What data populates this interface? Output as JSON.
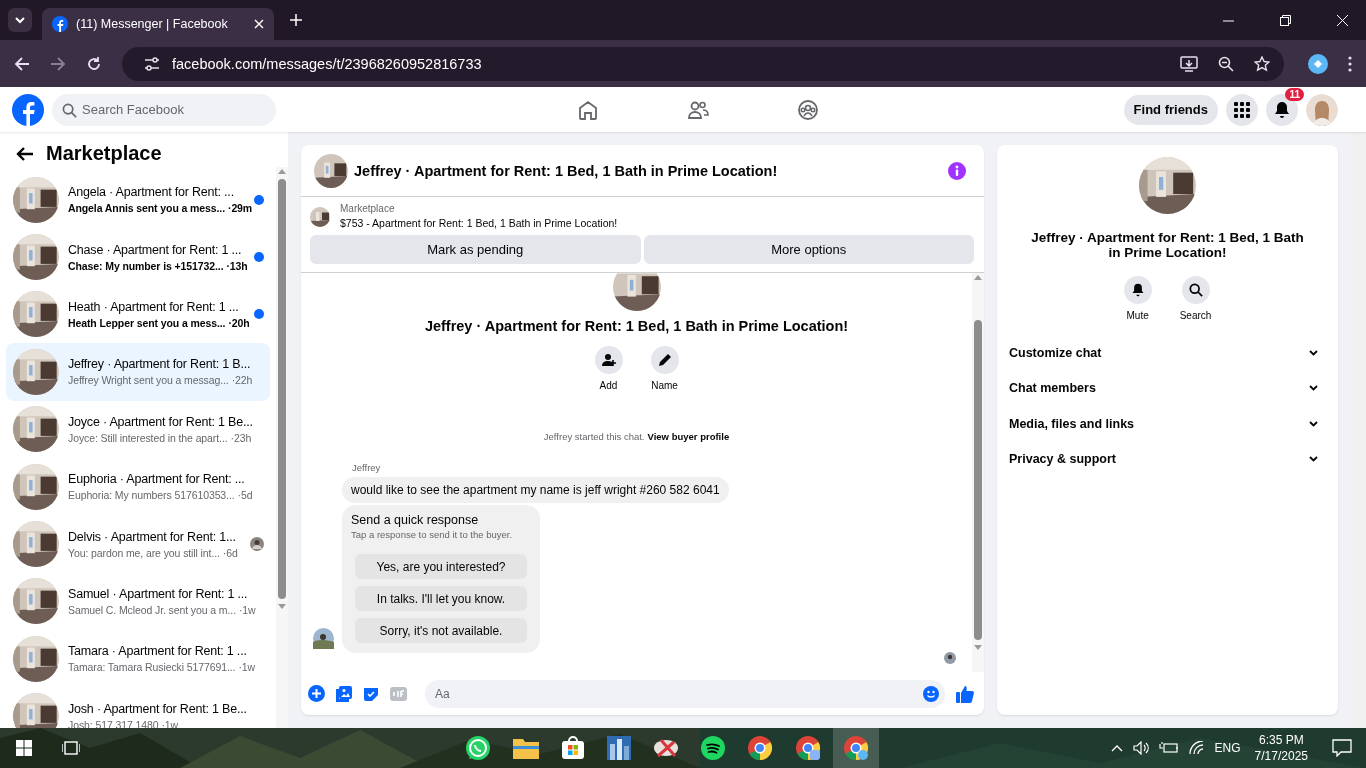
{
  "browser": {
    "tab_title": "(11) Messenger | Facebook",
    "url": "facebook.com/messages/t/23968260952816733"
  },
  "header": {
    "search_placeholder": "Search Facebook",
    "find_friends": "Find friends",
    "notification_count": "11"
  },
  "sidebar": {
    "title": "Marketplace",
    "conversations": [
      {
        "title": "Angela · Apartment for Rent: ...",
        "preview": "Angela Annis sent you a mess...",
        "time": "·29m",
        "unread": true,
        "seen": false,
        "selected": false
      },
      {
        "title": "Chase · Apartment for Rent: 1 ...",
        "preview": "Chase: My number is +151732...",
        "time": "·13h",
        "unread": true,
        "seen": false,
        "selected": false
      },
      {
        "title": "Heath · Apartment for Rent: 1 ...",
        "preview": "Heath Lepper sent you a mess...",
        "time": "·20h",
        "unread": true,
        "seen": false,
        "selected": false
      },
      {
        "title": "Jeffrey · Apartment for Rent: 1 B...",
        "preview": "Jeffrey Wright sent you a messag...",
        "time": "·22h",
        "unread": false,
        "seen": false,
        "selected": true
      },
      {
        "title": "Joyce · Apartment for Rent: 1 Be...",
        "preview": "Joyce: Still interested in the apart...",
        "time": "·23h",
        "unread": false,
        "seen": false,
        "selected": false
      },
      {
        "title": "Euphoria · Apartment for Rent: ...",
        "preview": "Euphoria: My numbers 517610353...",
        "time": "·5d",
        "unread": false,
        "seen": false,
        "selected": false
      },
      {
        "title": "Delvis · Apartment for Rent: 1...",
        "preview": "You: pardon me, are you still int...",
        "time": "·6d",
        "unread": false,
        "seen": true,
        "selected": false
      },
      {
        "title": "Samuel · Apartment for Rent: 1 ...",
        "preview": "Samuel C. Mcleod Jr. sent you a m...",
        "time": "·1w",
        "unread": false,
        "seen": false,
        "selected": false
      },
      {
        "title": "Tamara · Apartment for Rent: 1 ...",
        "preview": "Tamara: Tamara Rusiecki 5177691...",
        "time": "·1w",
        "unread": false,
        "seen": false,
        "selected": false
      },
      {
        "title": "Josh · Apartment for Rent: 1 Be...",
        "preview": "Josh: 517 317 1480",
        "time": "·1w",
        "unread": false,
        "seen": false,
        "selected": false
      }
    ]
  },
  "chat": {
    "title": "Jeffrey · Apartment for Rent: 1 Bed, 1 Bath in Prime Location!",
    "listing": {
      "label": "Marketplace",
      "price_line": "$753 - Apartment for Rent: 1 Bed, 1 Bath in Prime Location!",
      "buttons": [
        "Mark as pending",
        "More options"
      ]
    },
    "intro": {
      "title": "Jeffrey · Apartment for Rent: 1 Bed, 1 Bath in Prime Location!",
      "actions": [
        {
          "label": "Add",
          "kind": "add"
        },
        {
          "label": "Name",
          "kind": "name"
        }
      ]
    },
    "notice": {
      "text": "Jeffrey started this chat.",
      "link": "View buyer profile"
    },
    "sender": "Jeffrey",
    "message": "would like to see the apartment  my name is jeff wright #260 582 6041",
    "quick_response": {
      "title": "Send a quick response",
      "subtitle": "Tap a response to send it to the buyer.",
      "options": [
        "Yes, are you interested?",
        "In talks. I'll let you know.",
        "Sorry, it's not available."
      ]
    },
    "composer_placeholder": "Aa"
  },
  "details": {
    "title": "Jeffrey · Apartment for Rent: 1 Bed, 1 Bath in Prime Location!",
    "actions": [
      {
        "label": "Mute",
        "kind": "mute"
      },
      {
        "label": "Search",
        "kind": "search"
      }
    ],
    "sections": [
      {
        "label": "Customize chat",
        "expanded": false
      },
      {
        "label": "Chat members",
        "expanded": false
      },
      {
        "label": "Media, files and links",
        "expanded": false
      },
      {
        "label": "Privacy & support",
        "expanded": false
      }
    ]
  },
  "taskbar": {
    "language": "ENG",
    "time": "6:35 PM",
    "date": "7/17/2025"
  }
}
